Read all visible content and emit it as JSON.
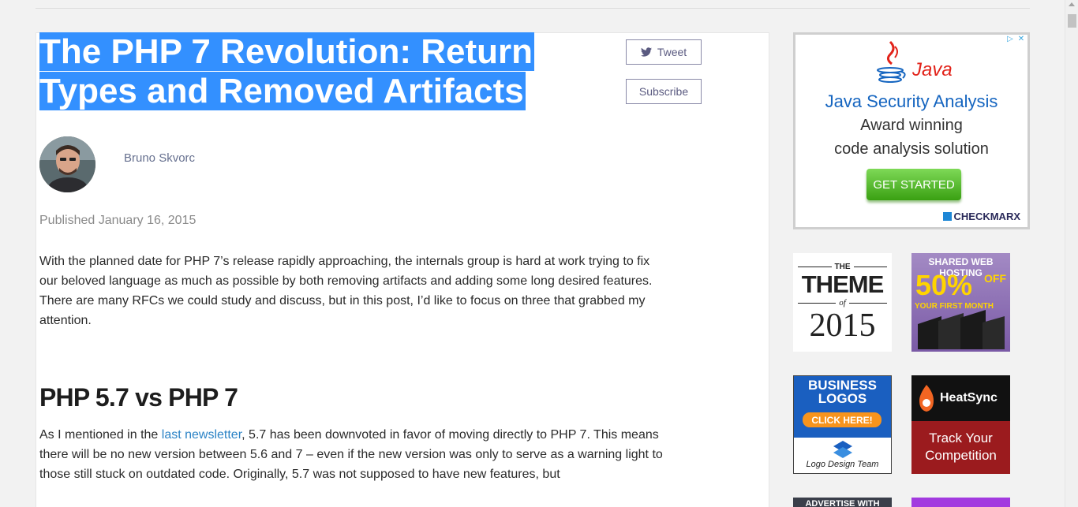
{
  "article": {
    "title_line1": "The PHP 7 Revolution: Return",
    "title_line2": "Types and Removed Artifacts",
    "tweet_label": "Tweet",
    "subscribe_label": "Subscribe",
    "author": "Bruno Skvorc",
    "published": "Published January 16, 2015",
    "intro": "With the planned date for PHP 7’s release rapidly approaching, the internals group is hard at work trying to fix our beloved language as much as possible by both removing artifacts and adding some long desired features. There are many RFCs we could study and discuss, but in this post, I’d like to focus on three that grabbed my attention.",
    "section_heading": "PHP 5.7 vs PHP 7",
    "p2_before": "As I mentioned in the ",
    "p2_link": "last newsletter",
    "p2_after": ", 5.7 has been downvoted in favor of moving directly to PHP 7. This means there will be no new version between 5.6 and 7 – even if the new version was only to serve as a warning light to those still stuck on outdated code. Originally, 5.7 was not supposed to have new features, but"
  },
  "ads": {
    "java": {
      "brand": "Java",
      "headline": "Java Security Analysis",
      "line1": "Award winning",
      "line2": "code analysis solution",
      "cta": "GET STARTED",
      "sponsor": "CHECKMARX"
    },
    "theme": {
      "the": "THE",
      "word": "THEME",
      "of": "of",
      "year": "2015"
    },
    "hosting": {
      "top": "SHARED WEB HOSTING",
      "percent": "50%",
      "off": "OFF",
      "sub": "YOUR FIRST MONTH"
    },
    "logos": {
      "line1": "BUSINESS",
      "line2": "LOGOS",
      "cta": "CLICK HERE!",
      "brand": "Logo Design Team"
    },
    "heatsync": {
      "brand": "HeatSync",
      "line1": "Track Your",
      "line2": "Competition"
    },
    "bottom_left": "ADVERTISE WITH"
  }
}
